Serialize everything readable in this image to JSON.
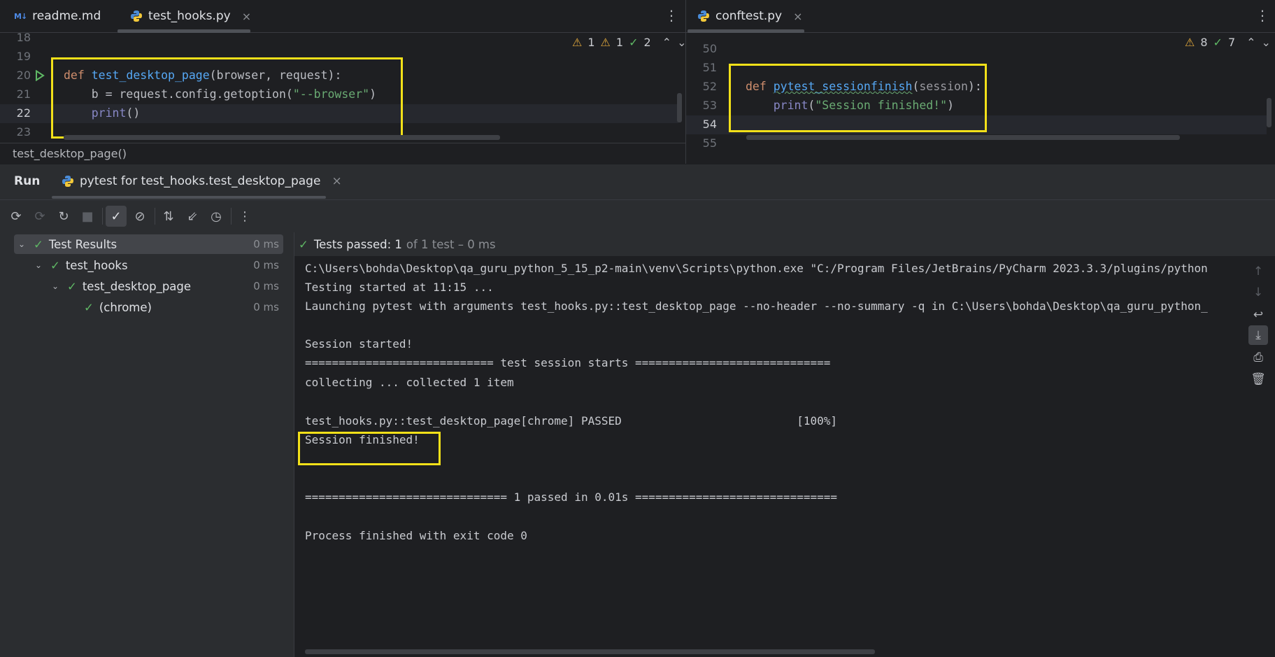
{
  "left_editor": {
    "tabs": [
      {
        "icon": "markdown-icon",
        "icon_text": "M↓",
        "label": "readme.md"
      },
      {
        "icon": "python-icon",
        "label": "test_hooks.py",
        "close": "×"
      }
    ],
    "inspections": {
      "warn1": "1",
      "warn2": "1",
      "ok": "2"
    },
    "line_numbers": [
      "18",
      "19",
      "20",
      "21",
      "22",
      "23"
    ],
    "code": {
      "l20_kw": "def",
      "l20_fn": "test_desktop_page",
      "l20_rest": "(browser, request):",
      "l21_a": "    b = request.config.getoption(",
      "l21_str": "\"--browser\"",
      "l21_b": ")",
      "l22_indent": "    ",
      "l22_fn": "print",
      "l22_rest": "()"
    },
    "breadcrumb": "test_desktop_page()"
  },
  "right_editor": {
    "tabs": [
      {
        "icon": "python-icon",
        "label": "conftest.py",
        "close": "×"
      }
    ],
    "inspections": {
      "warn": "8",
      "ok": "7"
    },
    "line_numbers": [
      "50",
      "51",
      "52",
      "53",
      "54",
      "55"
    ],
    "code": {
      "l52_kw": "def",
      "l52_fn": "pytest_sessionfinish",
      "l52_open": "(",
      "l52_param": "session",
      "l52_close": "):",
      "l53_indent": "    ",
      "l53_fn": "print",
      "l53_open": "(",
      "l53_str": "\"Session finished!\"",
      "l53_close": ")"
    }
  },
  "run": {
    "title": "Run",
    "tab_label": "pytest for test_hooks.test_desktop_page",
    "tab_close": "×",
    "tree": [
      {
        "label": "Test Results",
        "time": "0 ms"
      },
      {
        "label": "test_hooks",
        "time": "0 ms"
      },
      {
        "label": "test_desktop_page",
        "time": "0 ms"
      },
      {
        "label": "(chrome)",
        "time": "0 ms"
      }
    ],
    "status": {
      "passed": "Tests passed: 1",
      "detail": "of 1 test – 0 ms"
    },
    "console_lines": [
      "C:\\Users\\bohda\\Desktop\\qa_guru_python_5_15_p2-main\\venv\\Scripts\\python.exe \"C:/Program Files/JetBrains/PyCharm 2023.3.3/plugins/python",
      "Testing started at 11:15 ...",
      "Launching pytest with arguments test_hooks.py::test_desktop_page --no-header --no-summary -q in C:\\Users\\bohda\\Desktop\\qa_guru_python_",
      "",
      "Session started!",
      "============================ test session starts =============================",
      "collecting ... collected 1 item",
      "",
      "test_hooks.py::test_desktop_page[chrome] PASSED                          [100%]",
      "Session finished!",
      "",
      "",
      "============================== 1 passed in 0.01s ==============================",
      "",
      "Process finished with exit code 0"
    ]
  },
  "colors": {
    "highlight": "#f2e019",
    "pass": "#5fb865",
    "warning": "#e2a93c"
  }
}
